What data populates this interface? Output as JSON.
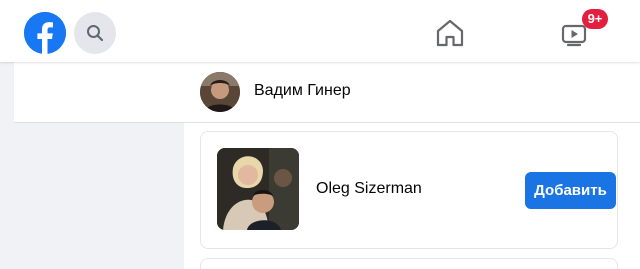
{
  "topbar": {
    "logo_icon": "facebook-logo-icon",
    "search_icon": "search-icon",
    "home_icon": "home-icon",
    "watch_icon": "watch-video-icon",
    "watch_badge": "9+"
  },
  "profile": {
    "name": "Вадим Гинер"
  },
  "friend_suggestion": {
    "name": "Oleg Sizerman",
    "add_label": "Добавить"
  },
  "colors": {
    "brand": "#1877f2",
    "button": "#1b74e4",
    "badge": "#e41e3f",
    "page_bg": "#f0f2f5"
  }
}
